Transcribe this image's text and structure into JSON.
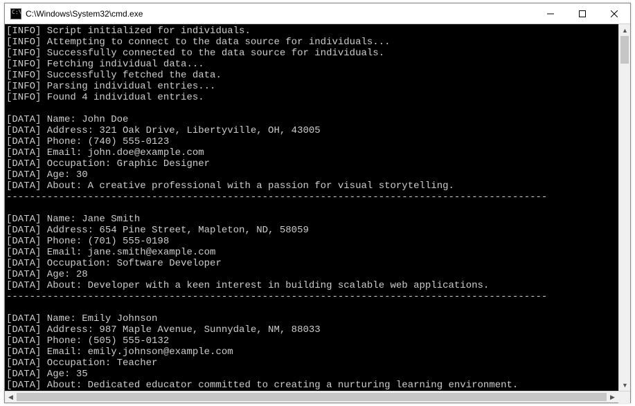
{
  "window": {
    "title": "C:\\Windows\\System32\\cmd.exe"
  },
  "log": {
    "info_prefix": "[INFO]",
    "data_prefix": "[DATA]",
    "info_lines": [
      "Script initialized for individuals.",
      "Attempting to connect to the data source for individuals...",
      "Successfully connected to the data source for individuals.",
      "Fetching individual data...",
      "Successfully fetched the data.",
      "Parsing individual entries...",
      "Found 4 individual entries."
    ],
    "separator": "---------------------------------------------------------------------------------------------",
    "records": [
      {
        "Name": "John Doe",
        "Address": "321 Oak Drive, Libertyville, OH, 43005",
        "Phone": "(740) 555-0123",
        "Email": "john.doe@example.com",
        "Occupation": "Graphic Designer",
        "Age": "30",
        "About": "A creative professional with a passion for visual storytelling."
      },
      {
        "Name": "Jane Smith",
        "Address": "654 Pine Street, Mapleton, ND, 58059",
        "Phone": "(701) 555-0198",
        "Email": "jane.smith@example.com",
        "Occupation": "Software Developer",
        "Age": "28",
        "About": "Developer with a keen interest in building scalable web applications."
      },
      {
        "Name": "Emily Johnson",
        "Address": "987 Maple Avenue, Sunnydale, NM, 88033",
        "Phone": "(505) 555-0132",
        "Email": "emily.johnson@example.com",
        "Occupation": "Teacher",
        "Age": "35",
        "About": "Dedicated educator committed to creating a nurturing learning environment."
      }
    ],
    "field_order": [
      "Name",
      "Address",
      "Phone",
      "Email",
      "Occupation",
      "Age",
      "About"
    ]
  }
}
